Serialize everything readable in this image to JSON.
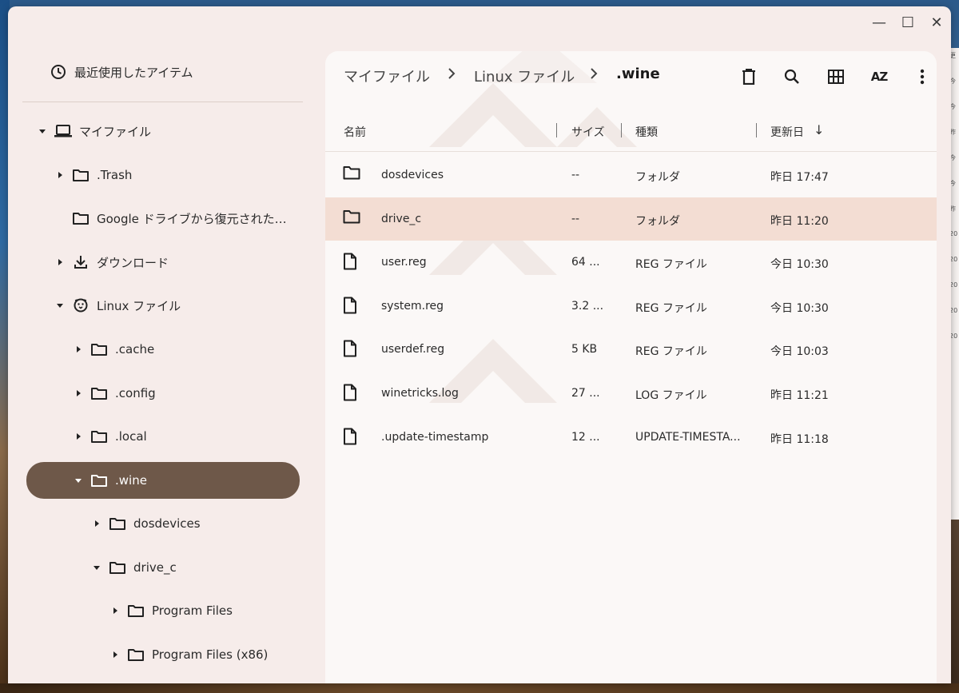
{
  "window": {
    "controls": {
      "minimize": "—",
      "maximize": "☐",
      "close": "✕"
    }
  },
  "sidebar": {
    "recent_label": "最近使用したアイテム",
    "items": [
      {
        "label": "マイファイル",
        "icon": "laptop-icon",
        "expanded": true
      },
      {
        "label": ".Trash",
        "icon": "folder-icon"
      },
      {
        "label": "Google ドライブから復元された…",
        "icon": "folder-icon"
      },
      {
        "label": "ダウンロード",
        "icon": "download-icon"
      },
      {
        "label": "Linux ファイル",
        "icon": "penguin-icon",
        "expanded": true
      },
      {
        "label": ".cache",
        "icon": "folder-icon"
      },
      {
        "label": ".config",
        "icon": "folder-icon"
      },
      {
        "label": ".local",
        "icon": "folder-icon"
      },
      {
        "label": ".wine",
        "icon": "folder-icon",
        "selected": true,
        "expanded": true
      },
      {
        "label": "dosdevices",
        "icon": "folder-icon"
      },
      {
        "label": "drive_c",
        "icon": "folder-icon",
        "expanded": true
      },
      {
        "label": "Program Files",
        "icon": "folder-icon"
      },
      {
        "label": "Program Files (x86)",
        "icon": "folder-icon"
      }
    ]
  },
  "breadcrumb": {
    "items": [
      "マイファイル",
      "Linux ファイル",
      ".wine"
    ],
    "separator": ">"
  },
  "toolbar": {
    "icons": [
      "delete-icon",
      "search-icon",
      "grid-view-icon",
      "sort-icon",
      "more-vert-icon"
    ],
    "sort_text": "AZ"
  },
  "columns": {
    "name": "名前",
    "size": "サイズ",
    "type": "種類",
    "date": "更新日",
    "sort_arrow": "↓"
  },
  "files": [
    {
      "name": "dosdevices",
      "size": "--",
      "type": "フォルダ",
      "date": "昨日 17:47",
      "kind": "folder"
    },
    {
      "name": "drive_c",
      "size": "--",
      "type": "フォルダ",
      "date": "昨日 11:20",
      "kind": "folder",
      "selected": true
    },
    {
      "name": "user.reg",
      "size": "64 ...",
      "type": "REG ファイル",
      "date": "今日 10:30",
      "kind": "file"
    },
    {
      "name": "system.reg",
      "size": "3.2 ...",
      "type": "REG ファイル",
      "date": "今日 10:30",
      "kind": "file"
    },
    {
      "name": "userdef.reg",
      "size": "5 KB",
      "type": "REG ファイル",
      "date": "今日 10:03",
      "kind": "file"
    },
    {
      "name": "winetricks.log",
      "size": "27 ...",
      "type": "LOG ファイル",
      "date": "昨日 11:21",
      "kind": "file"
    },
    {
      "name": ".update-timestamp",
      "size": "12 ...",
      "type": "UPDATE-TIMESTA...",
      "date": "昨日 11:18",
      "kind": "file"
    }
  ],
  "background_window": {
    "column_partial": "更",
    "dates_partial": [
      "今",
      "今",
      "昨",
      "今",
      "今",
      "昨",
      "20",
      "20",
      "20",
      "20",
      "20"
    ]
  },
  "colors": {
    "accent": "#6e5849",
    "selected_row": "#f3ddd3",
    "window_bg": "#f6ecea"
  }
}
